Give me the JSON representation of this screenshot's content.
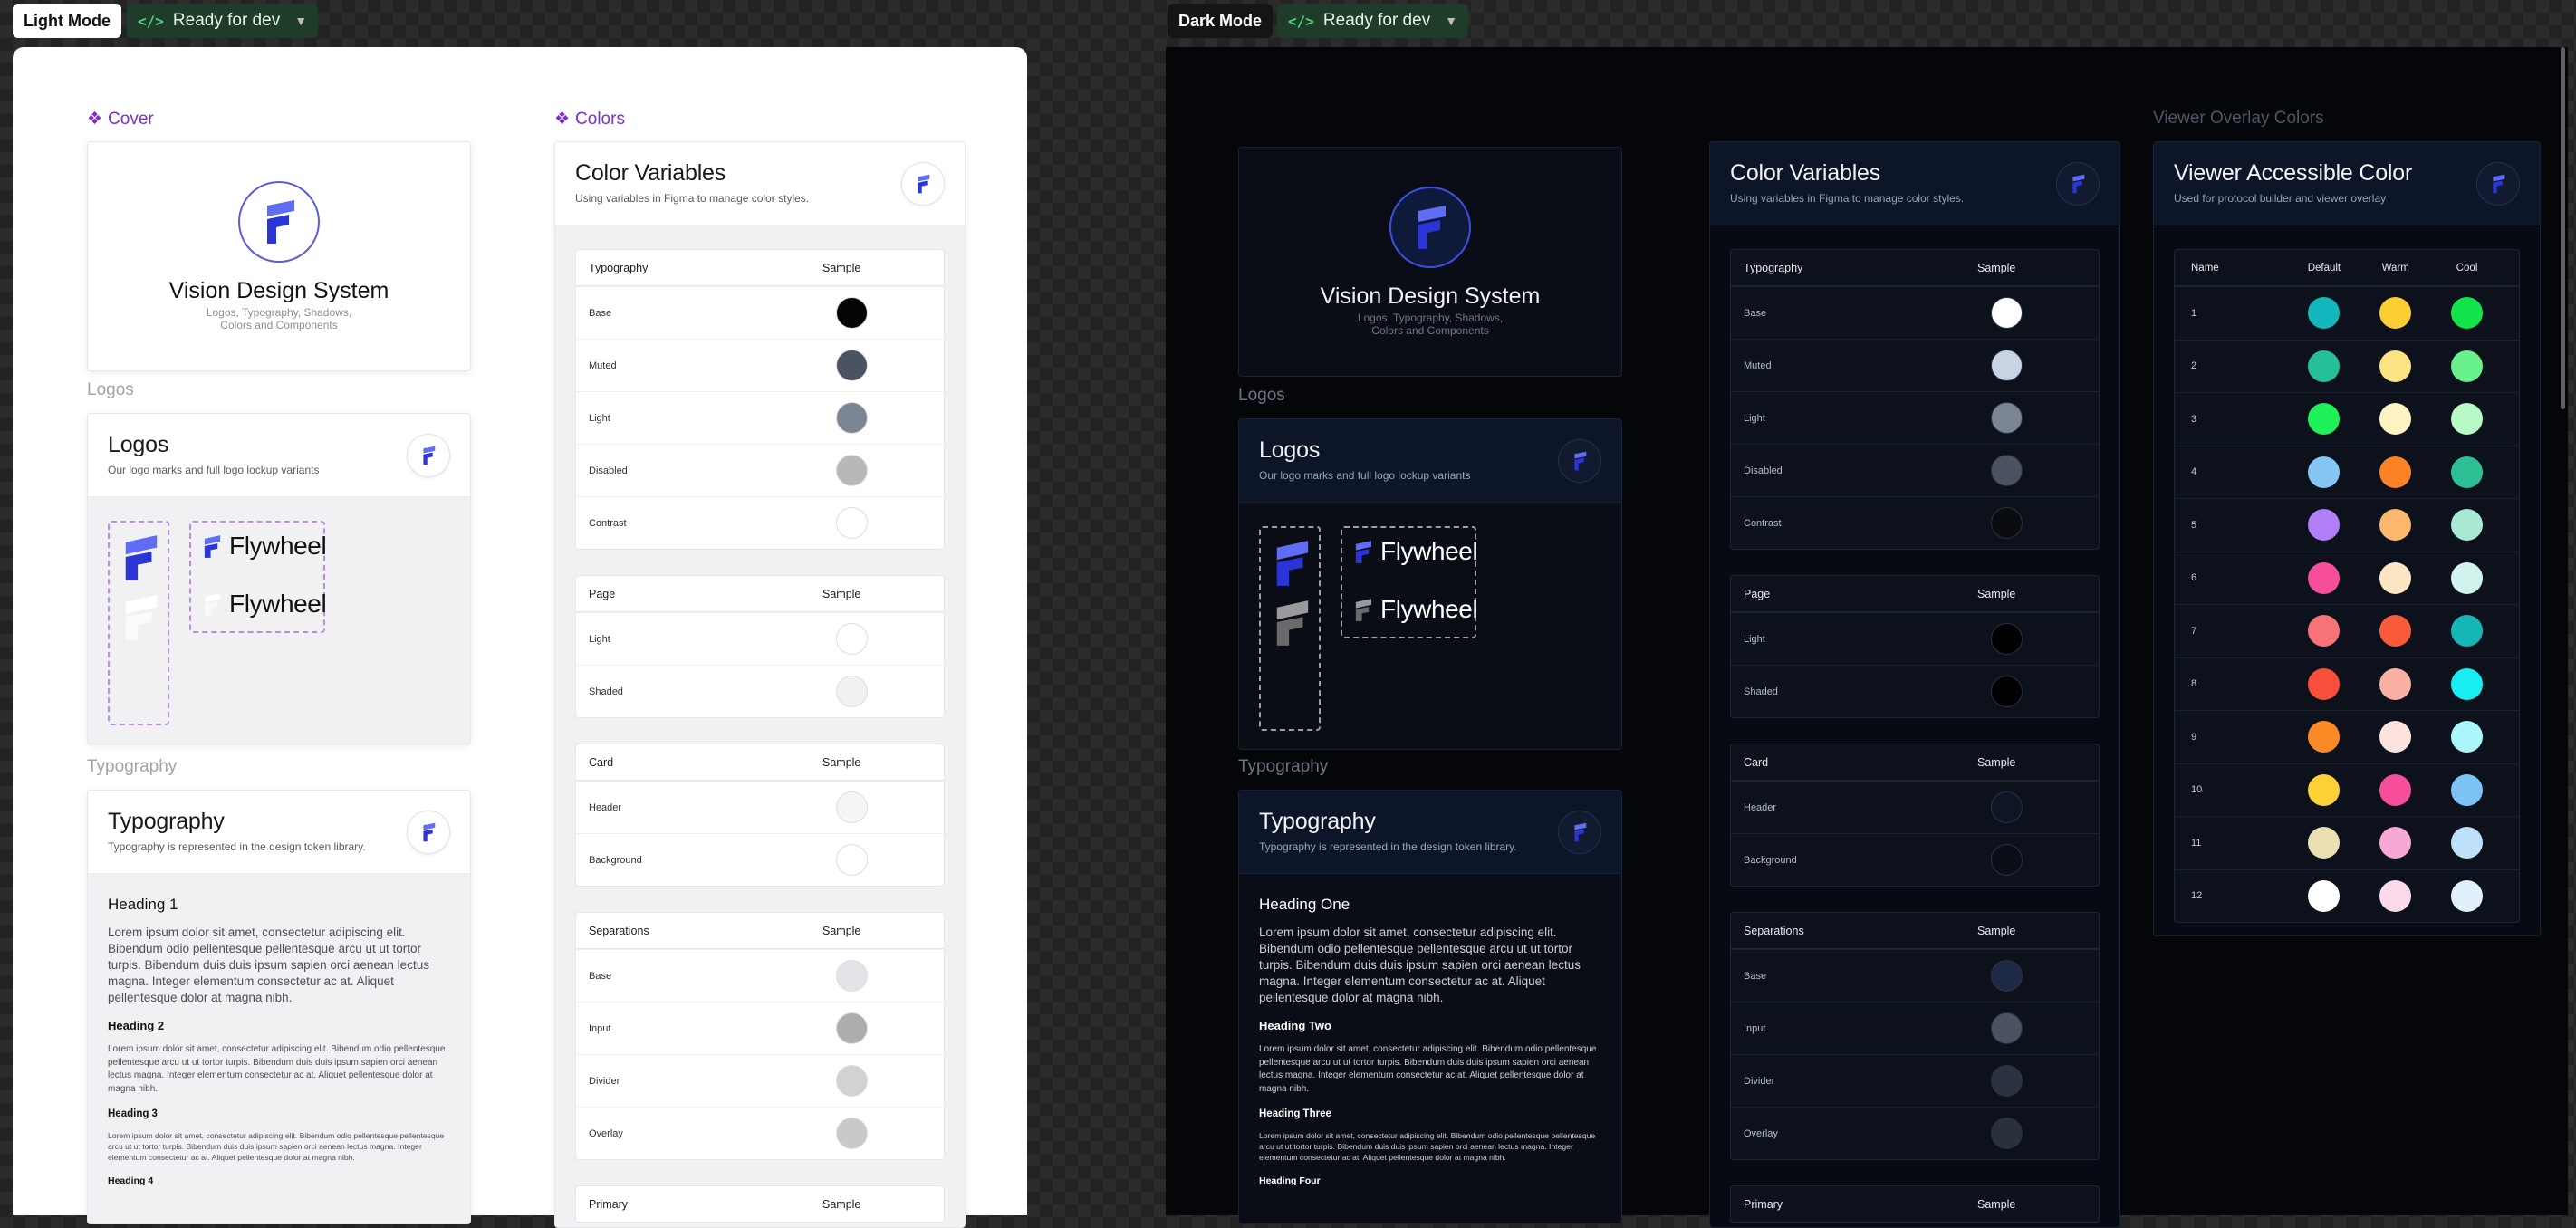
{
  "light": {
    "mode_label": "Light Mode",
    "dev_status": "Ready for dev",
    "sections": {
      "cover": "Cover",
      "colors": "Colors",
      "logos": "Logos",
      "typography": "Typography"
    },
    "cover": {
      "title": "Vision Design System",
      "subtitle": "Logos, Typography, Shadows, Colors and Components"
    },
    "logos_card": {
      "title": "Logos",
      "subtitle": "Our logo marks and full logo lockup variants",
      "wordmark": "Flywheel"
    },
    "typography_card": {
      "title": "Typography",
      "subtitle": "Typography is represented in the design token library.",
      "h1": "Heading 1",
      "h2": "Heading 2",
      "h3": "Heading 3",
      "h4": "Heading 4",
      "body": "Lorem ipsum dolor sit amet, consectetur adipiscing elit. Bibendum odio pellentesque pellentesque arcu ut ut tortor turpis. Bibendum duis duis ipsum sapien orci aenean lectus magna. Integer elementum consectetur ac at. Aliquet pellentesque dolor at magna nibh."
    },
    "colors_card": {
      "title": "Color Variables",
      "subtitle": "Using variables in Figma to manage color styles.",
      "sample_header": "Sample",
      "groups": [
        {
          "name": "Typography",
          "rows": [
            {
              "label": "Base",
              "color": "#050505"
            },
            {
              "label": "Muted",
              "color": "#4b5260"
            },
            {
              "label": "Light",
              "color": "#7b8594"
            },
            {
              "label": "Disabled",
              "color": "#b8b8b8"
            },
            {
              "label": "Contrast",
              "color": "#ffffff"
            }
          ]
        },
        {
          "name": "Page",
          "rows": [
            {
              "label": "Light",
              "color": "#ffffff"
            },
            {
              "label": "Shaded",
              "color": "#f1f1f3"
            }
          ]
        },
        {
          "name": "Card",
          "rows": [
            {
              "label": "Header",
              "color": "#f5f5f7"
            },
            {
              "label": "Background",
              "color": "#ffffff"
            }
          ]
        },
        {
          "name": "Separations",
          "rows": [
            {
              "label": "Base",
              "color": "#e2e4e8"
            },
            {
              "label": "Input",
              "color": "#adadad"
            },
            {
              "label": "Divider",
              "color": "#d2d2d2"
            },
            {
              "label": "Overlay",
              "color": "#c9c9c9"
            }
          ]
        },
        {
          "name": "Primary",
          "rows": []
        }
      ]
    }
  },
  "dark": {
    "mode_label": "Dark Mode",
    "dev_status": "Ready for dev",
    "sections": {
      "logos": "Logos",
      "typography": "Typography",
      "viewer": "Viewer Overlay Colors"
    },
    "cover": {
      "title": "Vision Design System",
      "subtitle": "Logos, Typography, Shadows, Colors and Components"
    },
    "logos_card": {
      "title": "Logos",
      "subtitle": "Our logo marks and full logo lockup variants",
      "wordmark": "Flywheel"
    },
    "typography_card": {
      "title": "Typography",
      "subtitle": "Typography is represented in the design token library.",
      "h1": "Heading One",
      "h2": "Heading Two",
      "h3": "Heading Three",
      "h4": "Heading Four",
      "body": "Lorem ipsum dolor sit amet, consectetur adipiscing elit. Bibendum odio pellentesque pellentesque arcu ut ut tortor turpis. Bibendum duis duis ipsum sapien orci aenean lectus magna. Integer elementum consectetur ac at. Aliquet pellentesque dolor at magna nibh."
    },
    "colors_card": {
      "title": "Color Variables",
      "subtitle": "Using variables in Figma to manage color styles.",
      "sample_header": "Sample",
      "groups": [
        {
          "name": "Typography",
          "rows": [
            {
              "label": "Base",
              "color": "#ffffff"
            },
            {
              "label": "Muted",
              "color": "#c8d4e4"
            },
            {
              "label": "Light",
              "color": "#7b8594"
            },
            {
              "label": "Disabled",
              "color": "#4b5260"
            },
            {
              "label": "Contrast",
              "color": "#0a0c10"
            }
          ]
        },
        {
          "name": "Page",
          "rows": [
            {
              "label": "Light",
              "color": "#000000"
            },
            {
              "label": "Shaded",
              "color": "#000000"
            }
          ]
        },
        {
          "name": "Card",
          "rows": [
            {
              "label": "Header",
              "color": "#0e1626"
            },
            {
              "label": "Background",
              "color": "#0a0e17"
            }
          ]
        },
        {
          "name": "Separations",
          "rows": [
            {
              "label": "Base",
              "color": "#1e2a44"
            },
            {
              "label": "Input",
              "color": "#4c5260"
            },
            {
              "label": "Divider",
              "color": "#2c3240"
            },
            {
              "label": "Overlay",
              "color": "#2a303c"
            }
          ]
        },
        {
          "name": "Primary",
          "rows": []
        }
      ]
    },
    "viewer_card": {
      "title": "Viewer Accessible Color",
      "subtitle": "Used for protocol builder and viewer overlay",
      "headers": [
        "Name",
        "Default",
        "Warm",
        "Cool"
      ],
      "rows": [
        {
          "name": "1",
          "default": "#13b8be",
          "warm": "#fbcf32",
          "cool": "#14e44c"
        },
        {
          "name": "2",
          "default": "#24c199",
          "warm": "#fde283",
          "cool": "#68f08a"
        },
        {
          "name": "3",
          "default": "#1ef05a",
          "warm": "#fff3c4",
          "cool": "#b6f9c4"
        },
        {
          "name": "4",
          "default": "#84c7f4",
          "warm": "#fb8225",
          "cool": "#2fbf95"
        },
        {
          "name": "5",
          "default": "#b07ff6",
          "warm": "#fbb86c",
          "cool": "#a8e8d4"
        },
        {
          "name": "6",
          "default": "#f74e9b",
          "warm": "#fde6c4",
          "cool": "#d2f2ee"
        },
        {
          "name": "7",
          "default": "#f87377",
          "warm": "#f95a3c",
          "cool": "#16b6b6"
        },
        {
          "name": "8",
          "default": "#f84e3c",
          "warm": "#fbb0a6",
          "cool": "#18eef2"
        },
        {
          "name": "9",
          "default": "#fb8926",
          "warm": "#fde3df",
          "cool": "#aaf7fb"
        },
        {
          "name": "10",
          "default": "#fcd237",
          "warm": "#f74e9b",
          "cool": "#7cc3f6"
        },
        {
          "name": "11",
          "default": "#ebe0b4",
          "warm": "#f7a8d4",
          "cool": "#bfe0fb"
        },
        {
          "name": "12",
          "default": "#ffffff",
          "warm": "#fcdaea",
          "cool": "#e2f0fc"
        }
      ]
    }
  }
}
